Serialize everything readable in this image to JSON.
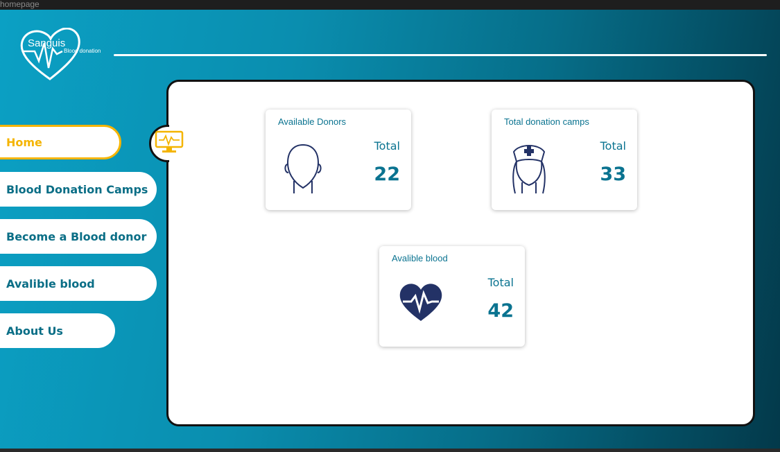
{
  "frame": {
    "label": "homepage"
  },
  "logo": {
    "name": "Sanguis",
    "subtitle": "Blood donation"
  },
  "nav": {
    "items": [
      {
        "label": "Home",
        "active": true
      },
      {
        "label": "Blood Donation Camps",
        "active": false
      },
      {
        "label": "Become a Blood donor",
        "active": false
      },
      {
        "label": "Avalible blood",
        "active": false
      },
      {
        "label": "About Us",
        "active": false
      }
    ]
  },
  "dashboard": {
    "cards": [
      {
        "title": "Available Donors",
        "total_label": "Total",
        "total_value": "22",
        "icon": "person-icon"
      },
      {
        "title": "Total donation camps",
        "total_label": "Total",
        "total_value": "33",
        "icon": "nurse-icon"
      },
      {
        "title": "Avalible blood",
        "total_label": "Total",
        "total_value": "42",
        "icon": "heartbeat-icon"
      }
    ]
  },
  "colors": {
    "accent": "#f4b400",
    "primary_text": "#0a7390",
    "icon_navy": "#233266",
    "gradient_start": "#0ba0c4",
    "gradient_end": "#03394a"
  }
}
